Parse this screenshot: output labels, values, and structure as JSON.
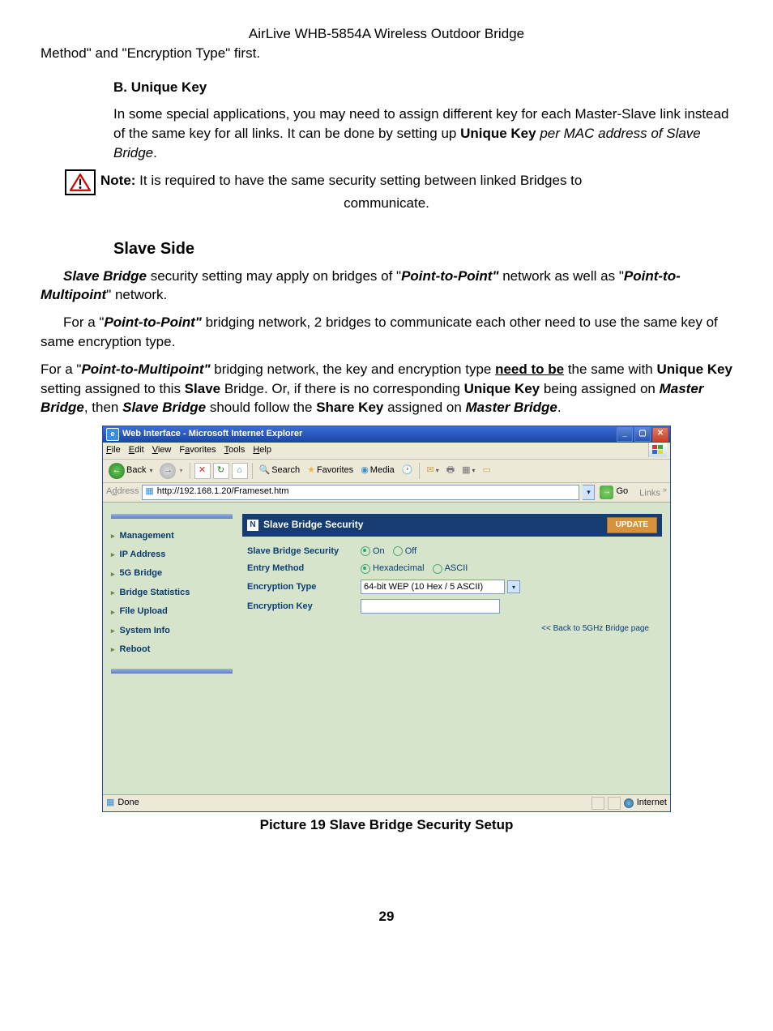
{
  "doc": {
    "header": "AirLive WHB-5854A Wireless Outdoor Bridge",
    "line1": "Method\" and \"Encryption Type\" first.",
    "sectionB": "B.   Unique Key",
    "paraB": "In some special applications, you may need to assign different key for each Master-Slave link instead of the same key for all links.    It can be done by setting up ",
    "paraB_bold": "Unique Key",
    "paraB_ital": " per MAC address of Slave Bridge",
    "paraB_end": ".",
    "note_label": "Note:",
    "note_text": " It is required to have the same security setting between linked Bridges to",
    "note_line2": "communicate.",
    "slave_side": "Slave Side",
    "p1_a": "Slave Bridge",
    "p1_b": " security setting may apply on bridges of \"",
    "p1_c": "Point-to-Point\"",
    "p1_d": " network as well as \"",
    "p1_e": "Point-to-Multipoint",
    "p1_f": "\" network.",
    "p2_a": "For a \"",
    "p2_b": "Point-to-Point\"",
    "p2_c": " bridging network, 2 bridges to communicate each other need to use the same key of same encryption type.",
    "p3_a": "For a \"",
    "p3_b": "Point-to-Multipoint\"",
    "p3_c": " bridging network, the key and encryption type ",
    "p3_d": "need to be",
    "p3_e": " the same with ",
    "p3_f": "Unique Key",
    "p3_g": " setting assigned to this ",
    "p3_h": "Slave",
    "p3_i": " Bridge. Or, if there is no corresponding ",
    "p3_j": "Unique Key",
    "p3_k": " being assigned on ",
    "p3_l": "Master Bridge",
    "p3_m": ", then ",
    "p3_n": "Slave Bridge",
    "p3_o": " should follow the ",
    "p3_p": "Share Key",
    "p3_q": " assigned on ",
    "p3_r": "Master Bridge",
    "p3_s": ".",
    "caption": "Picture 19 Slave Bridge Security Setup",
    "page": "29"
  },
  "ie": {
    "title": "Web Interface - Microsoft Internet Explorer",
    "menu": {
      "file": "File",
      "edit": "Edit",
      "view": "View",
      "fav": "Favorites",
      "tools": "Tools",
      "help": "Help"
    },
    "tb": {
      "back": "Back",
      "search": "Search",
      "favorites": "Favorites",
      "media": "Media"
    },
    "addr_label": "Address",
    "addr_value": "http://192.168.1.20/Frameset.htm",
    "go": "Go",
    "links": "Links",
    "nav": [
      "Management",
      "IP Address",
      "5G Bridge",
      "Bridge Statistics",
      "File Upload",
      "System Info",
      "Reboot"
    ],
    "panel_title": "Slave Bridge Security",
    "update": "UPDATE",
    "rows": {
      "r1": "Slave Bridge Security",
      "r1_on": "On",
      "r1_off": "Off",
      "r2": "Entry Method",
      "r2_hex": "Hexadecimal",
      "r2_asc": "ASCII",
      "r3": "Encryption Type",
      "r3_val": "64-bit WEP (10 Hex / 5 ASCII)",
      "r4": "Encryption Key"
    },
    "back_link": "<< Back to 5GHz Bridge page",
    "status_done": "Done",
    "status_zone": "Internet"
  }
}
